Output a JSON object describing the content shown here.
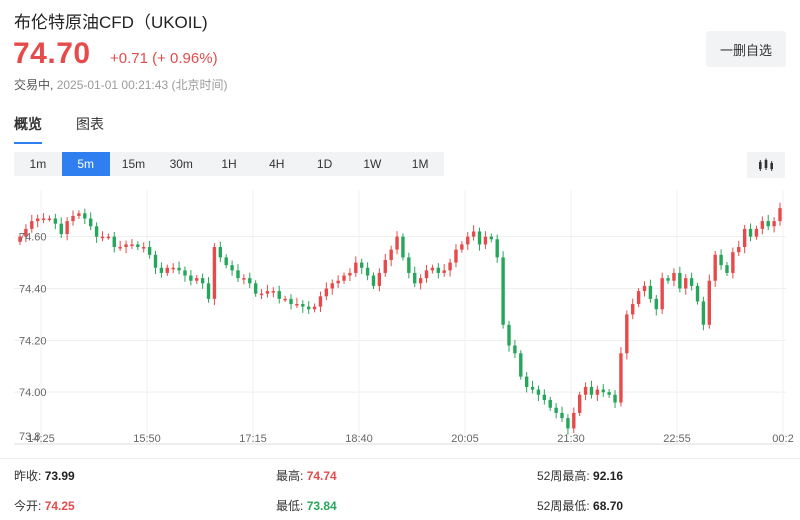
{
  "header": {
    "title": "布伦特原油CFD（UKOIL)",
    "price": "74.70",
    "change": "+0.71 (+ 0.96%)",
    "status": "交易中,",
    "timestamp": "2025-01-01 00:21:43 (北京时间)",
    "remove_watchlist": "一删自选"
  },
  "tabs": [
    {
      "label": "概览",
      "active": true
    },
    {
      "label": "图表",
      "active": false
    }
  ],
  "ranges": [
    {
      "label": "1m",
      "active": false
    },
    {
      "label": "5m",
      "active": true
    },
    {
      "label": "15m",
      "active": false
    },
    {
      "label": "30m",
      "active": false
    },
    {
      "label": "1H",
      "active": false
    },
    {
      "label": "4H",
      "active": false
    },
    {
      "label": "1D",
      "active": false
    },
    {
      "label": "1W",
      "active": false
    },
    {
      "label": "1M",
      "active": false
    }
  ],
  "colors": {
    "up": "#e64b4b",
    "down": "#26a65b",
    "accent": "#2f7ff0"
  },
  "chart_data": {
    "type": "candlestick",
    "y_ticks": [
      "74.60",
      "74.40",
      "74.20",
      "74.00",
      "73.8"
    ],
    "y_tick_values": [
      74.6,
      74.4,
      74.2,
      74.0,
      73.8
    ],
    "x_ticks": [
      "14:25",
      "15:50",
      "17:15",
      "18:40",
      "20:05",
      "21:30",
      "22:55",
      "00:2"
    ],
    "ylim": [
      73.8,
      74.78
    ],
    "grid": true,
    "closes": [
      74.6,
      74.63,
      74.66,
      74.67,
      74.67,
      74.67,
      74.65,
      74.61,
      74.66,
      74.68,
      74.69,
      74.67,
      74.64,
      74.6,
      74.6,
      74.6,
      74.56,
      74.56,
      74.57,
      74.57,
      74.56,
      74.56,
      74.53,
      74.48,
      74.46,
      74.48,
      74.48,
      74.47,
      74.45,
      74.43,
      74.44,
      74.42,
      74.36,
      74.56,
      74.52,
      74.49,
      74.47,
      74.44,
      74.44,
      74.42,
      74.38,
      74.38,
      74.39,
      74.39,
      74.36,
      74.36,
      74.34,
      74.34,
      74.33,
      74.32,
      74.33,
      74.37,
      74.4,
      74.42,
      74.43,
      74.45,
      74.46,
      74.5,
      74.48,
      74.45,
      74.41,
      74.46,
      74.51,
      74.55,
      74.6,
      74.52,
      74.46,
      74.42,
      74.44,
      74.47,
      74.48,
      74.46,
      74.47,
      74.5,
      74.55,
      74.57,
      74.6,
      74.62,
      74.57,
      74.6,
      74.59,
      74.52,
      74.26,
      74.18,
      74.15,
      74.06,
      74.02,
      74.01,
      73.99,
      73.97,
      73.94,
      73.92,
      73.9,
      73.86,
      73.92,
      73.99,
      74.02,
      73.99,
      74.01,
      74.0,
      73.99,
      73.96,
      74.15,
      74.3,
      74.34,
      74.39,
      74.41,
      74.36,
      74.32,
      74.44,
      74.43,
      74.46,
      74.4,
      74.44,
      74.41,
      74.35,
      74.26,
      74.43,
      74.53,
      74.49,
      74.46,
      74.54,
      74.56,
      74.63,
      74.6,
      74.63,
      74.66,
      74.64,
      74.66,
      74.71
    ]
  },
  "stats": [
    [
      {
        "label": "昨收:",
        "value": "73.99",
        "color": "dark"
      },
      {
        "label": "最高:",
        "value": "74.74",
        "color": "red"
      },
      {
        "label": "52周最高:",
        "value": "92.16",
        "color": "dark"
      }
    ],
    [
      {
        "label": "今开:",
        "value": "74.25",
        "color": "red"
      },
      {
        "label": "最低:",
        "value": "73.84",
        "color": "green"
      },
      {
        "label": "52周最低:",
        "value": "68.70",
        "color": "dark"
      }
    ]
  ]
}
